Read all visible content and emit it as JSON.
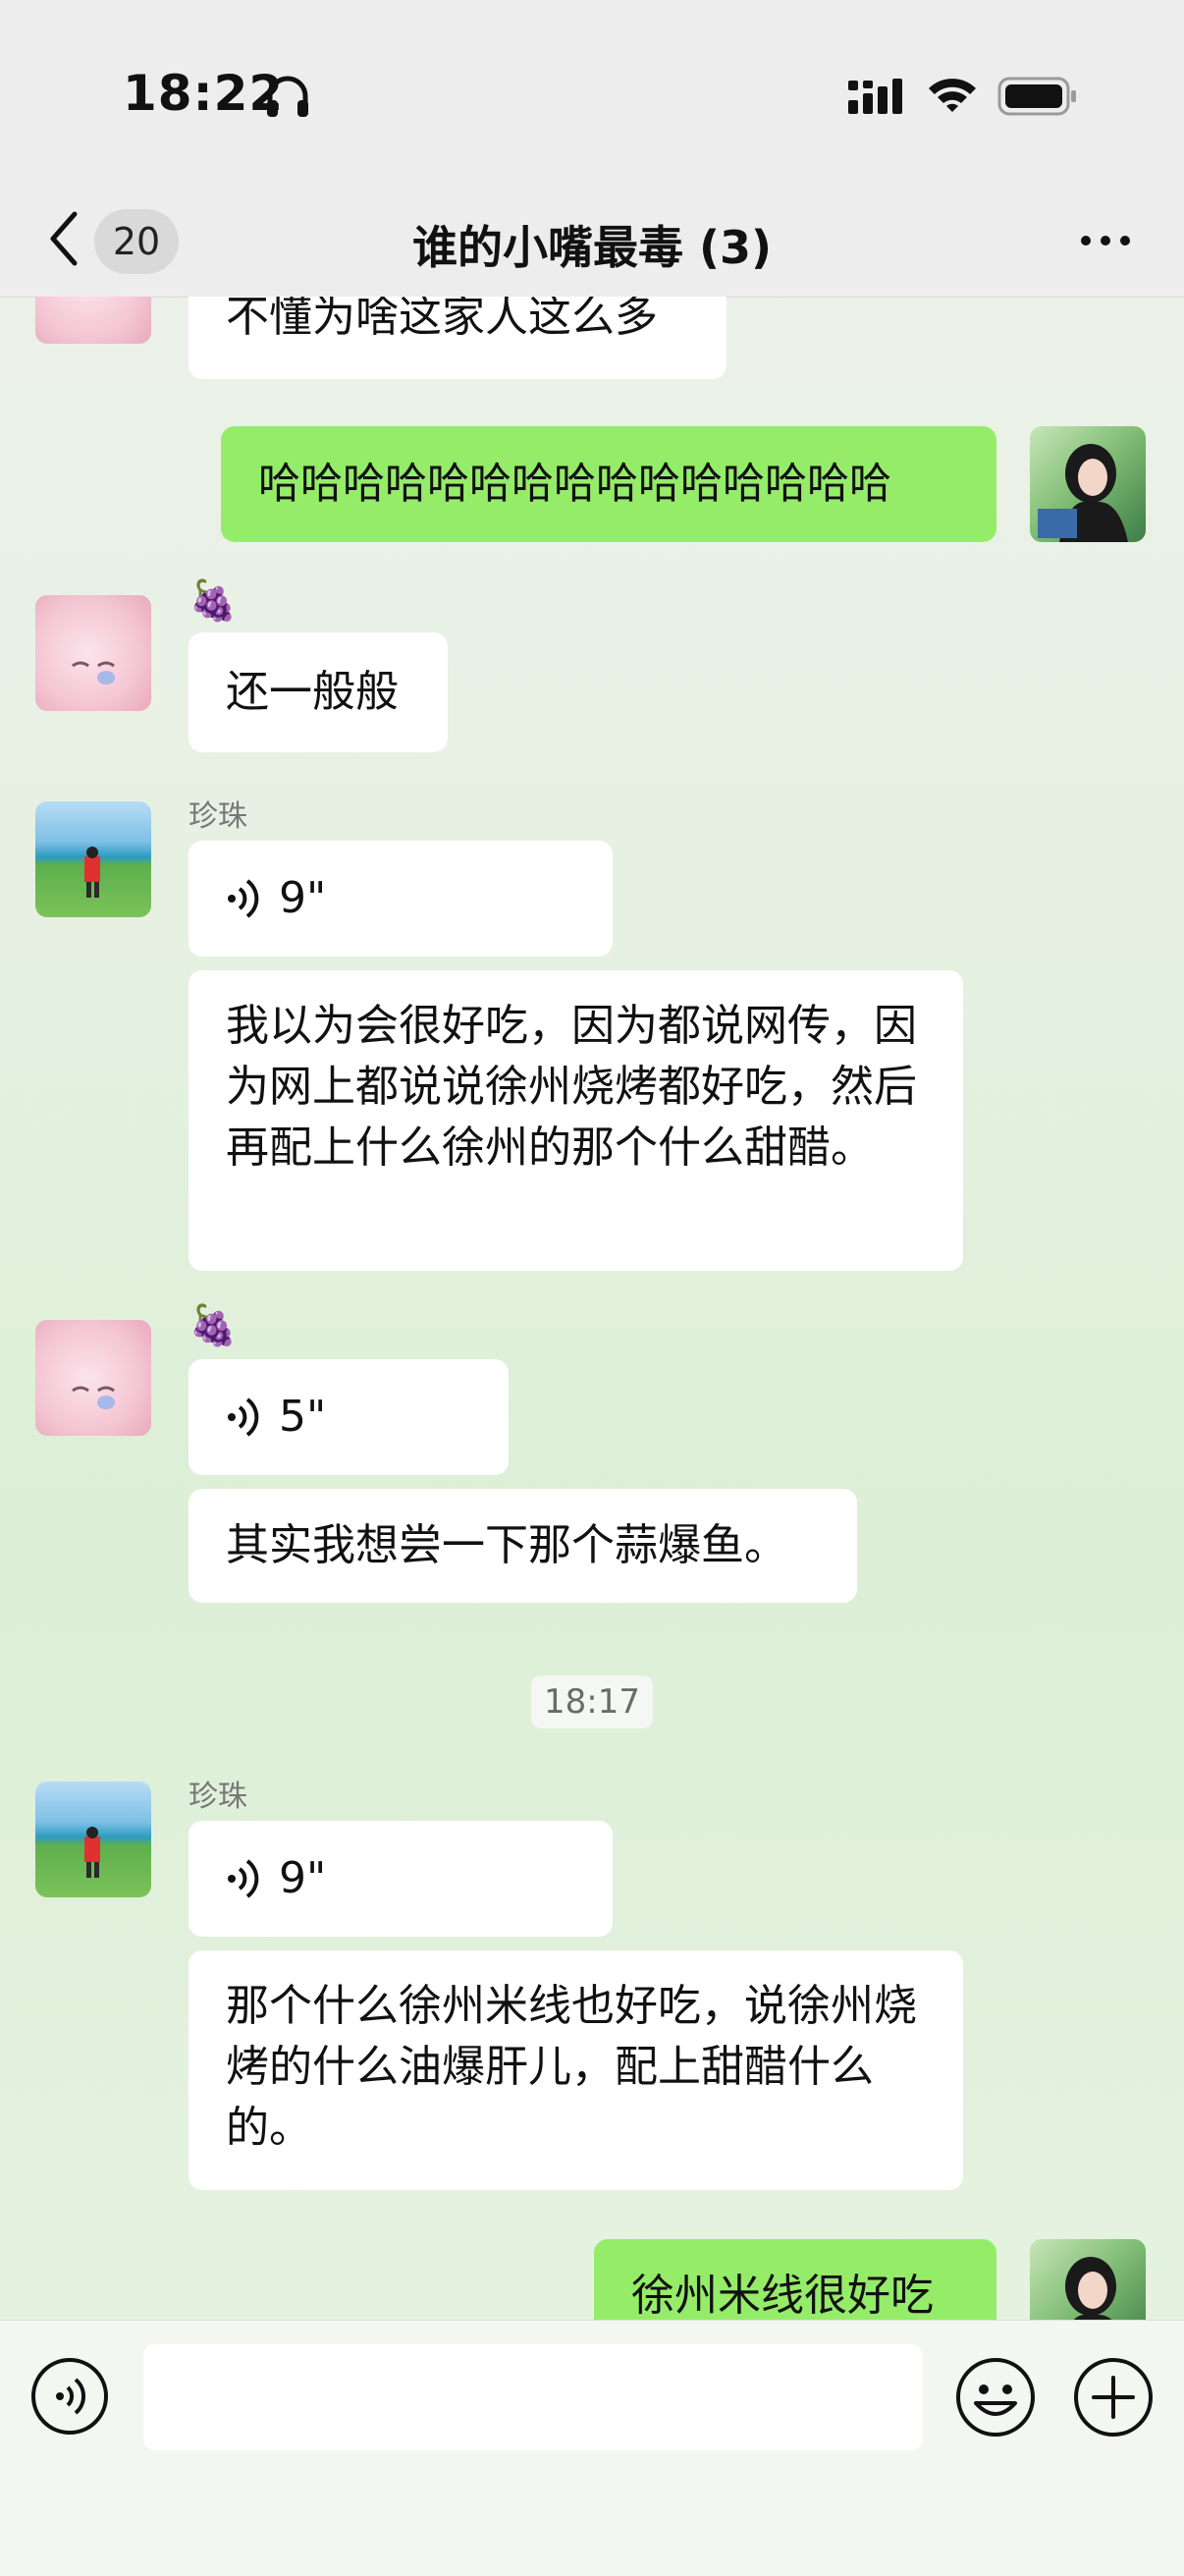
{
  "status_bar": {
    "time": "18:22"
  },
  "nav": {
    "unread_count": "20",
    "title": "谁的小嘴最毒 (3)"
  },
  "messages": {
    "m1_text": "不懂为啥这家人这么多",
    "m2_text": "哈哈哈哈哈哈哈哈哈哈哈哈哈哈哈",
    "m3_sender_emoji": "🍇",
    "m3_text": "还一般般",
    "m4_sender_name": "珍珠",
    "m4_voice_duration": "9\"",
    "m5_text": "我以为会很好吃，因为都说网传，因为网上都说说徐州烧烤都好吃，然后再配上什么徐州的那个什么甜醋。",
    "m6_sender_emoji": "🍇",
    "m6_voice_duration": "5\"",
    "m7_text": "其实我想尝一下那个蒜爆鱼。",
    "timestamp": "18:17",
    "m8_sender_name": "珍珠",
    "m8_voice_duration": "9\"",
    "m9_text": "那个什么徐州米线也好吃，说徐州烧烤的什么油爆肝儿，配上甜醋什么的。",
    "m10_text": "徐州米线很好吃"
  },
  "colors": {
    "my_bubble": "#95ec69",
    "other_bubble": "#ffffff",
    "bar_bg": "#ededed"
  }
}
